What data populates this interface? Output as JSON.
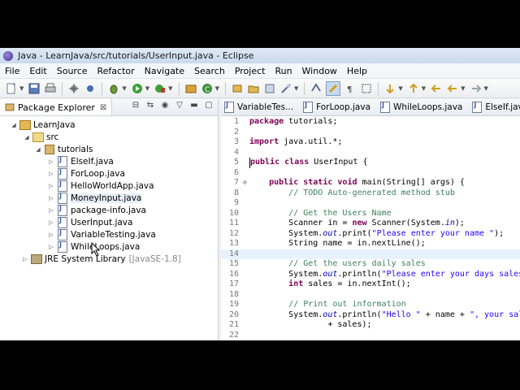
{
  "window": {
    "title": "Java - LearnJava/src/tutorials/UserInput.java - Eclipse"
  },
  "menu": [
    "File",
    "Edit",
    "Source",
    "Refactor",
    "Navigate",
    "Search",
    "Project",
    "Run",
    "Window",
    "Help"
  ],
  "explorer": {
    "tab_label": "Package Explorer",
    "close_glyph": "⊠",
    "project": "LearnJava",
    "src": "src",
    "package": "tutorials",
    "files": [
      "ElseIf.java",
      "ForLoop.java",
      "HelloWorldApp.java",
      "MoneyInput.java",
      "package-info.java",
      "UserInput.java",
      "VariableTesting.java",
      "WhileLoops.java"
    ],
    "jre_label": "JRE System Library",
    "jre_deco": "[JavaSE-1.8]"
  },
  "editor_tabs": [
    "VariableTes...",
    "ForLoop.java",
    "WhileLoops.java",
    "ElseIf.java"
  ],
  "code": {
    "line_numbers": [
      "1",
      "2",
      "3",
      "4",
      "5",
      "6",
      "7",
      "8",
      "9",
      "10",
      "11",
      "12",
      "13",
      "14",
      "15",
      "16",
      "17",
      "18",
      "19",
      "20",
      "21",
      "22"
    ],
    "l1_kw": "package",
    "l1_rest": " tutorials;",
    "l3_kw": "import",
    "l3_rest": " java.util.*;",
    "l5_kw1": "public",
    "l5_kw2": "class",
    "l5_rest": " UserInput {",
    "l7_kw1": "public",
    "l7_kw2": "static",
    "l7_kw3": "void",
    "l7_rest": " main(String[] args) {",
    "l8_cm": "// TODO Auto-generated method stub",
    "l10_cm": "// Get the Users Name",
    "l11_a": "Scanner in = ",
    "l11_kw": "new",
    "l11_b": " Scanner(System.",
    "l11_fld": "in",
    "l11_c": ");",
    "l12_a": "System.",
    "l12_fld": "out",
    "l12_b": ".print(",
    "l12_str": "\"Please enter your name \"",
    "l12_c": ");",
    "l13_a": "String name = in.nextLine();",
    "l15_cm": "// Get the users daily sales",
    "l16_a": "System.",
    "l16_fld": "out",
    "l16_b": ".println(",
    "l16_str": "\"Please enter your days sales t",
    "l17_kw": "int",
    "l17_rest": " sales = in.nextInt();",
    "l19_cm": "// Print out information",
    "l20_a": "System.",
    "l20_fld": "out",
    "l20_b": ".println(",
    "l20_str1": "\"Hello \"",
    "l20_c": " + name + ",
    "l20_str2": "\", your sales",
    "l21_a": "+ sales);",
    "fold_glyph": "⊖"
  },
  "colors": {
    "keyword": "#7f0055",
    "string": "#2a00ff",
    "comment": "#3f7f5f",
    "field": "#0000c0"
  }
}
